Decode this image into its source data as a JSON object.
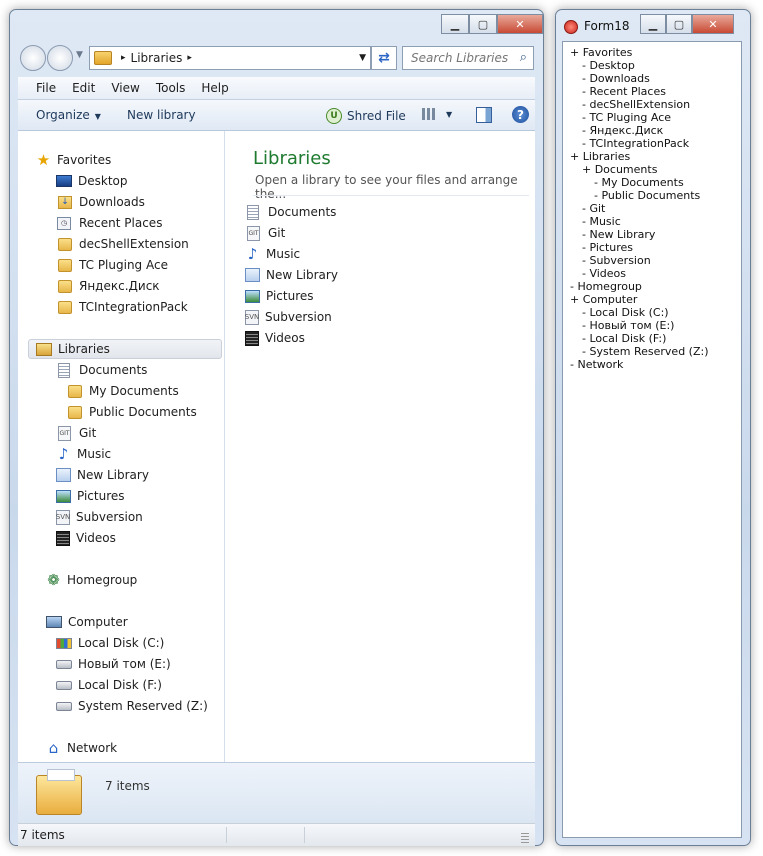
{
  "explorer": {
    "address": {
      "crumb": "Libraries",
      "separator": "▸"
    },
    "search": {
      "placeholder": "Search Libraries"
    },
    "menu": [
      "File",
      "Edit",
      "View",
      "Tools",
      "Help"
    ],
    "toolbar": {
      "organize": "Organize",
      "new_library": "New library",
      "shred_file": "Shred File"
    },
    "nav": {
      "favorites": {
        "label": "Favorites",
        "items": [
          "Desktop",
          "Downloads",
          "Recent Places",
          "decShellExtension",
          "TC Pluging Ace",
          "Яндекс.Диск",
          "TCIntegrationPack"
        ]
      },
      "libraries": {
        "label": "Libraries",
        "documents": "Documents",
        "my_documents": "My Documents",
        "public_documents": "Public Documents",
        "items": [
          "Git",
          "Music",
          "New Library",
          "Pictures",
          "Subversion",
          "Videos"
        ]
      },
      "homegroup": "Homegroup",
      "computer": {
        "label": "Computer",
        "drives": [
          "Local Disk (C:)",
          "Новый том (E:)",
          "Local Disk (F:)",
          "System Reserved (Z:)"
        ]
      },
      "network": "Network"
    },
    "content": {
      "title": "Libraries",
      "subtitle": "Open a library to see your files and arrange the...",
      "items": [
        "Documents",
        "Git",
        "Music",
        "New Library",
        "Pictures",
        "Subversion",
        "Videos"
      ]
    },
    "details": {
      "count": "7 items"
    },
    "status": {
      "text": "7 items"
    }
  },
  "form18": {
    "title": "Form18",
    "tree": [
      "+ Favorites",
      "- Desktop",
      "- Downloads",
      "- Recent Places",
      "- decShellExtension",
      "- TC Pluging Ace",
      "- Яндекс.Диск",
      "- TCIntegrationPack",
      "+ Libraries",
      "+ Documents",
      "- My Documents",
      "- Public Documents",
      "- Git",
      "- Music",
      "- New Library",
      "- Pictures",
      "- Subversion",
      "- Videos",
      "- Homegroup",
      "+ Computer",
      "- Local Disk (C:)",
      "- Новый том (E:)",
      "- Local Disk (F:)",
      "- System Reserved (Z:)",
      "- Network"
    ]
  }
}
